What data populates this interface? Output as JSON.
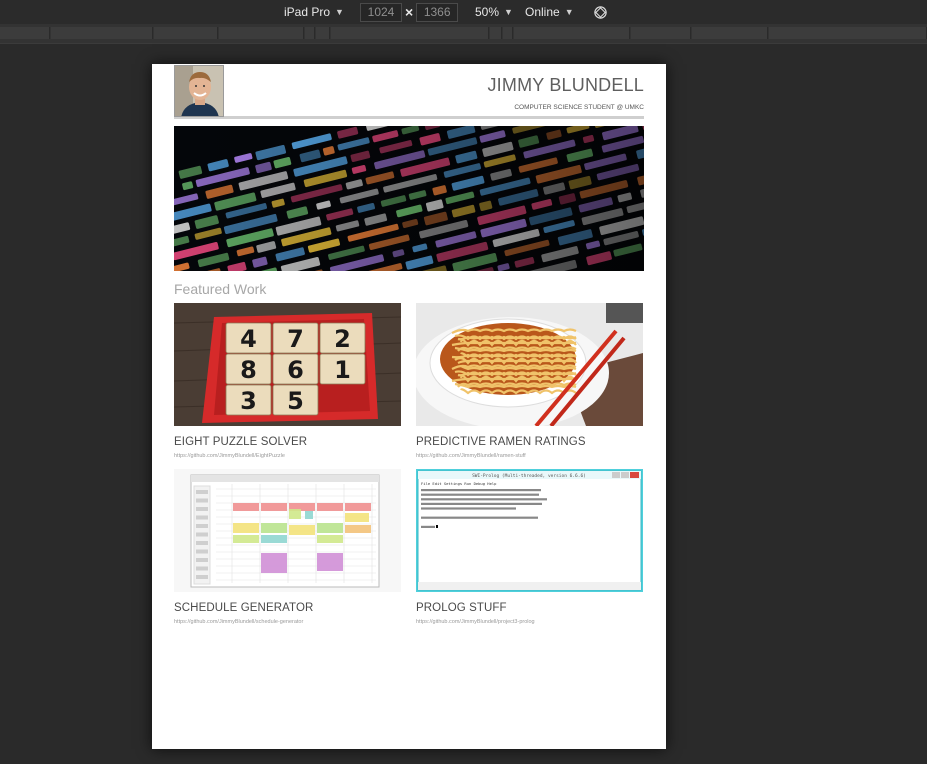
{
  "devtools": {
    "device": "iPad Pro",
    "width": "1024",
    "height": "1366",
    "times": "×",
    "zoom": "50%",
    "network": "Online",
    "caret": "▼",
    "rotate_icon": "rotate-icon"
  },
  "site": {
    "name": "JIMMY BLUNDELL",
    "tagline": "COMPUTER SCIENCE STUDENT @ UMKC",
    "section_title": "Featured Work",
    "projects": [
      {
        "title": "EIGHT PUZZLE SOLVER",
        "url": "https://github.com/JimmyBlundell/EightPuzzle",
        "tiles": [
          "4",
          "7",
          "2",
          "8",
          "6",
          "1",
          "3",
          "5"
        ]
      },
      {
        "title": "PREDICTIVE RAMEN RATINGS",
        "url": "https://github.com/JimmyBlundell/ramen-stuff"
      },
      {
        "title": "SCHEDULE GENERATOR",
        "url": "https://github.com/JimmyBlundell/schedule-generator"
      },
      {
        "title": "PROLOG STUFF",
        "url": "https://github.com/JimmyBlundell/project3-prolog",
        "window_title": "SWI-Prolog (Multi-threaded, version 6.6.6)",
        "menu": "File  Edit  Settings  Run  Debug  Help"
      }
    ]
  }
}
